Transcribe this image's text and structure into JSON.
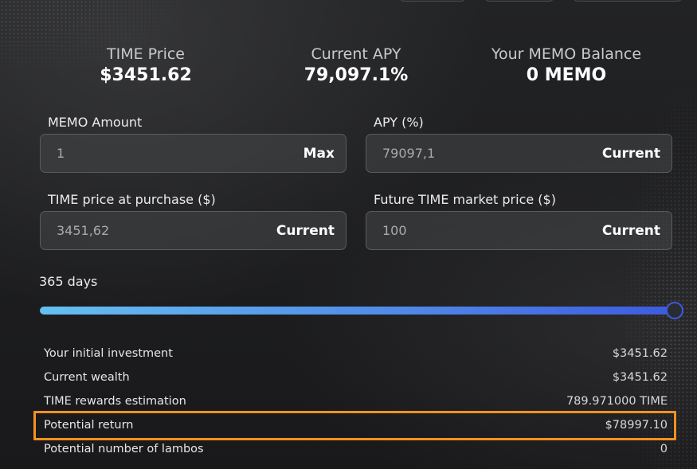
{
  "stats": {
    "time_price": {
      "label": "TIME Price",
      "value": "$3451.62"
    },
    "current_apy": {
      "label": "Current APY",
      "value": "79,097.1%"
    },
    "memo_balance": {
      "label": "Your MEMO Balance",
      "value": "0 MEMO"
    }
  },
  "inputs": {
    "memo_amount": {
      "label": "MEMO Amount",
      "value": "1",
      "action": "Max"
    },
    "apy": {
      "label": "APY (%)",
      "value": "79097,1",
      "action": "Current"
    },
    "purchase_price": {
      "label": "TIME price at purchase ($)",
      "value": "3451,62",
      "action": "Current"
    },
    "future_price": {
      "label": "Future TIME market price ($)",
      "value": "100",
      "action": "Current"
    }
  },
  "slider": {
    "label": "365 days",
    "fraction": 1.0
  },
  "results": [
    {
      "label": "Your initial investment",
      "value": "$3451.62"
    },
    {
      "label": "Current wealth",
      "value": "$3451.62"
    },
    {
      "label": "TIME rewards estimation",
      "value": "789.971000 TIME"
    },
    {
      "label": "Potential return",
      "value": "$78997.10"
    },
    {
      "label": "Potential number of lambos",
      "value": "0"
    }
  ],
  "colors": {
    "accent_slider_start": "#65bff0",
    "accent_slider_end": "#3d5bde",
    "highlight": "#f5921e"
  }
}
